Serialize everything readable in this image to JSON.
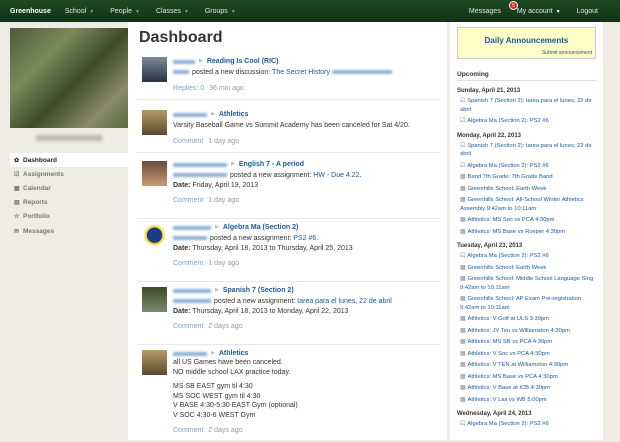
{
  "nav": {
    "brand": "Greenhouse",
    "items": [
      "School",
      "People",
      "Classes",
      "Groups"
    ],
    "messages": "Messages",
    "badge": "6",
    "account": "My account",
    "logout": "Logout"
  },
  "sidebar": {
    "items": [
      {
        "label": "Dashboard",
        "icon": "dashboard-icon"
      },
      {
        "label": "Assignments",
        "icon": "assignment-icon"
      },
      {
        "label": "Calendar",
        "icon": "calendar-icon"
      },
      {
        "label": "Reports",
        "icon": "report-icon"
      },
      {
        "label": "Portfolio",
        "icon": "star-icon"
      },
      {
        "label": "Messages",
        "icon": "envelope-icon"
      }
    ]
  },
  "main": {
    "title": "Dashboard",
    "posts": [
      {
        "group": "Reading Is Cool (RIC)",
        "text": "posted a new discussion:",
        "link": "The Secret History",
        "meta_link": "Replies: 0",
        "time": "36 min ago"
      },
      {
        "group": "Athletics",
        "text": "Varsity Baseball Game vs Summit Academy has been canceled for Sat 4/20.",
        "meta_link": "Comment",
        "time": "1 day ago"
      },
      {
        "group": "English 7 - A period",
        "text": "posted a new assignment:",
        "link": "HW - Due 4.22",
        "date_label": "Date:",
        "date": "Friday, April 19, 2013",
        "meta_link": "Comment",
        "time": "1 day ago"
      },
      {
        "group": "Algebra Ma (Section 2)",
        "text": "posted a new assignment:",
        "link": "PS2 #6",
        "date_label": "Date:",
        "date": "Thursday, April 18, 2013 to Thursday, April 25, 2013",
        "meta_link": "Comment",
        "time": "1 day ago"
      },
      {
        "group": "Spanish 7 (Section 2)",
        "text": "posted a new assignment:",
        "link": "tarea para el lunes, 22 de abril",
        "date_label": "Date:",
        "date": "Thursday, April 18, 2013 to Monday, April 22, 2013",
        "meta_link": "Comment",
        "time": "2 days ago"
      },
      {
        "group": "Athletics",
        "lines": [
          "all US Games have been canceled.",
          "NO middle school LAX practice today.",
          "",
          "MS SB EAST gym til 4:30",
          "MS SOC WEST gym til 4:30",
          "V BASE 4:30-5:30 EAST Gym (optional)",
          "V SOC 4:30-6 WEST Gym"
        ],
        "meta_link": "Comment",
        "time": "2 days ago"
      }
    ]
  },
  "right": {
    "announcements": "Daily Announcements",
    "submit": "Submit announcement",
    "upcoming": "Upcoming",
    "days": [
      {
        "day": "Sunday, April 21, 2013",
        "events": [
          {
            "i": "☑",
            "t": "Spanish 7 (Section 2): tarea para el lunes, 22 de abril"
          },
          {
            "i": "☑",
            "t": "Algebra Ma (Section 2): PS2 #6"
          }
        ]
      },
      {
        "day": "Monday, April 22, 2013",
        "events": [
          {
            "i": "☑",
            "t": "Spanish 7 (Section 2): tarea para el lunes, 22 de abril"
          },
          {
            "i": "☑",
            "t": "Algebra Ma (Section 2): PS2 #6"
          },
          {
            "i": "▦",
            "t": "Band 7th Grade: 7th Grade Band"
          },
          {
            "i": "▦",
            "t": "Greenhills School: Earth Week"
          },
          {
            "i": "▦",
            "t": "Greenhills School: All-School Winter Athletics Assembly 9:42am to 10:11am"
          },
          {
            "i": "▦",
            "t": "Athletics: MS Soc vs PCA 4:30pm"
          },
          {
            "i": "▦",
            "t": "Athletics: MS Base vs Roeper 4:30pm"
          }
        ]
      },
      {
        "day": "Tuesday, April 23, 2013",
        "events": [
          {
            "i": "☑",
            "t": "Algebra Ma (Section 2): PS2 #6"
          },
          {
            "i": "▦",
            "t": "Greenhills School: Earth Week"
          },
          {
            "i": "▦",
            "t": "Greenhills School: Middle School Language Sing 9:42am to 10:11am"
          },
          {
            "i": "▦",
            "t": "Greenhills School: AP Exam Pre-registration 9:42am to 10:11am"
          },
          {
            "i": "▦",
            "t": "Athletics: V Golf at ULS 3:30pm"
          },
          {
            "i": "▦",
            "t": "Athletics: JV Ten vs Williamston 4:30pm"
          },
          {
            "i": "▦",
            "t": "Athletics: MS SB vs PCA 4:30pm"
          },
          {
            "i": "▦",
            "t": "Athletics: V Soc vs PCA 4:30pm"
          },
          {
            "i": "▦",
            "t": "Athletics: V TEN at Williamston 4:30pm"
          },
          {
            "i": "▦",
            "t": "Athletics: MS Base vs PCA 4:30pm"
          },
          {
            "i": "▦",
            "t": "Athletics: V Base at ICB 4:30pm"
          },
          {
            "i": "▦",
            "t": "Athletics: V Lax vs WB 5:00pm"
          }
        ]
      },
      {
        "day": "Wednesday, April 24, 2013",
        "events": [
          {
            "i": "☑",
            "t": "Algebra Ma (Section 2): PS2 #6"
          }
        ]
      }
    ]
  },
  "colors": {
    "nav": "#1e4a22",
    "link": "#1a5a9a",
    "announce_bg": "#fdfdc8"
  }
}
